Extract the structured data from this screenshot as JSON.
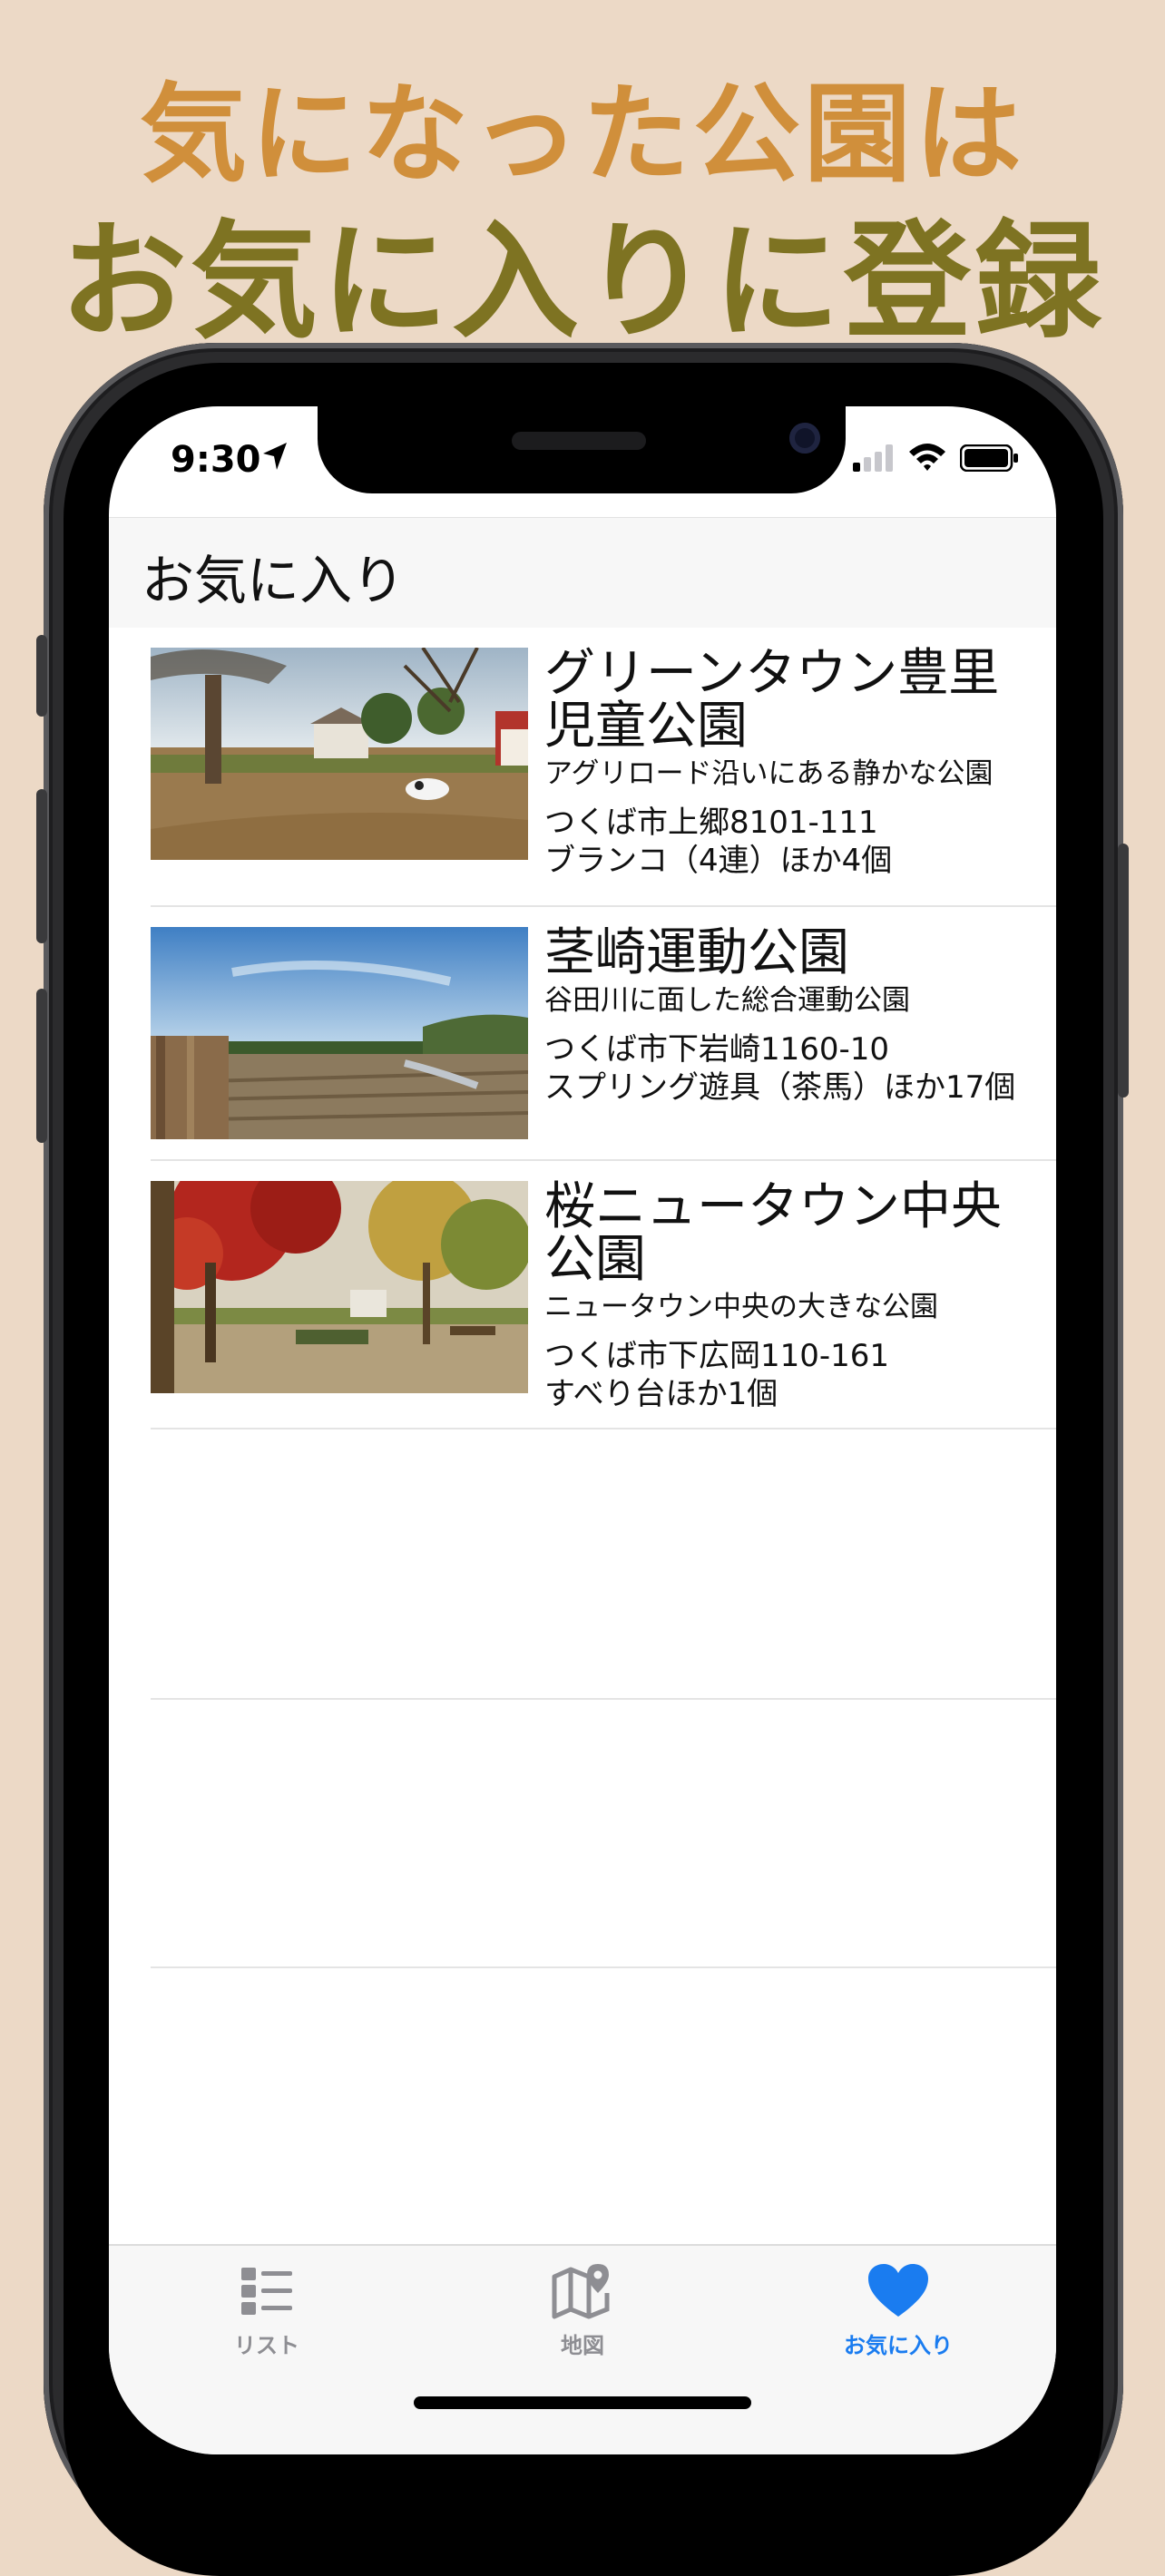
{
  "promo": {
    "line1": "気になった公園は",
    "line2": "お気に入りに登録"
  },
  "status_bar": {
    "time": "9:30"
  },
  "nav": {
    "title": "お気に入り"
  },
  "parks": [
    {
      "name": "グリーンタウン豊里児童公園",
      "description": "アグリロード沿いにある静かな公園",
      "address": "つくば市上郷8101-111",
      "equipment": "ブランコ（4連）ほか4個"
    },
    {
      "name": "茎崎運動公園",
      "description": "谷田川に面した総合運動公園",
      "address": "つくば市下岩崎1160-10",
      "equipment": "スプリング遊具（茶馬）ほか17個"
    },
    {
      "name": "桜ニュータウン中央公園",
      "description": "ニュータウン中央の大きな公園",
      "address": "つくば市下広岡110-161",
      "equipment": "すべり台ほか1個"
    }
  ],
  "tabs": [
    {
      "label": "リスト",
      "icon": "list-icon",
      "active": false
    },
    {
      "label": "地図",
      "icon": "map-icon",
      "active": false
    },
    {
      "label": "お気に入り",
      "icon": "heart-icon",
      "active": true
    }
  ],
  "colors": {
    "background": "#ecd9c6",
    "headline_orange": "#d08f3b",
    "headline_olive": "#7e7322",
    "active_tab": "#1a7cf0",
    "inactive_tab": "#8e8e93"
  }
}
